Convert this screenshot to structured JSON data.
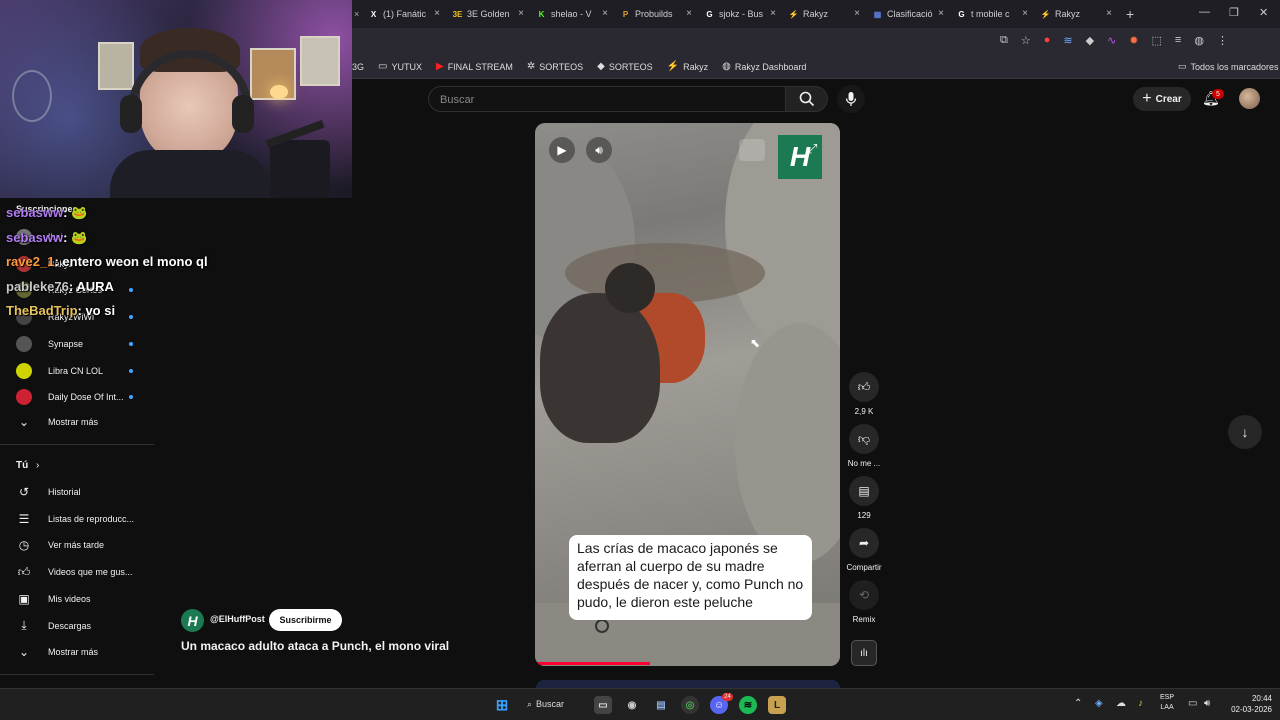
{
  "browser": {
    "tabs": [
      {
        "title": "(1) Fanátic",
        "icon": "x-icon",
        "color": "#ffffff"
      },
      {
        "title": "3E Golden",
        "icon": "3e-icon",
        "color": "#f0c020"
      },
      {
        "title": "shelao - V",
        "icon": "k-icon",
        "color": "#53fc18"
      },
      {
        "title": "Probuilds",
        "icon": "p-icon",
        "color": "#e0a030"
      },
      {
        "title": "sjokz - Bus",
        "icon": "google-icon",
        "color": "#ffffff"
      },
      {
        "title": "Rakyz",
        "icon": "rakyz-icon",
        "color": "#f0b040"
      },
      {
        "title": "Clasificació",
        "icon": "chart-icon",
        "color": "#5a7bd8"
      },
      {
        "title": "t mobile c",
        "icon": "google-icon",
        "color": "#ffffff"
      },
      {
        "title": "Rakyz",
        "icon": "rakyz-icon",
        "color": "#f0b040"
      }
    ],
    "bookmarks": [
      {
        "label": "3G",
        "icon": "none"
      },
      {
        "label": "YUTUX",
        "icon": "folder-icon"
      },
      {
        "label": "FINAL STREAM",
        "icon": "youtube-icon"
      },
      {
        "label": "SORTEOS",
        "icon": "gear-icon"
      },
      {
        "label": "SORTEOS",
        "icon": "diamond-icon"
      },
      {
        "label": "Rakyz",
        "icon": "rakyz-icon"
      },
      {
        "label": "Rakyz Dashboard",
        "icon": "globe-icon"
      }
    ],
    "all_bookmarks": "Todos los marcadores"
  },
  "youtube": {
    "search_placeholder": "Buscar",
    "create_label": "Crear",
    "notifications": "5"
  },
  "sidebar": {
    "subscriptions_header": "Suscripciones",
    "channels": [
      {
        "label": "Ibai",
        "dot": false
      },
      {
        "label": "Rakyz",
        "dot": true
      },
      {
        "label": "Rakyz Cortes",
        "dot": true
      },
      {
        "label": "RakyzWiWi",
        "dot": true
      },
      {
        "label": "Synapse",
        "dot": true
      },
      {
        "label": "Libra CN LOL",
        "dot": true
      },
      {
        "label": "Daily Dose Of Int...",
        "dot": true
      }
    ],
    "show_more_1": "Mostrar más",
    "you_header": "Tú",
    "you_items": [
      {
        "label": "Historial",
        "icon": "history-icon"
      },
      {
        "label": "Listas de reproducc...",
        "icon": "playlist-icon"
      },
      {
        "label": "Ver más tarde",
        "icon": "clock-icon"
      },
      {
        "label": "Videos que me gus...",
        "icon": "thumb-up-icon"
      },
      {
        "label": "Mis videos",
        "icon": "my-videos-icon"
      },
      {
        "label": "Descargas",
        "icon": "download-icon"
      }
    ],
    "show_more_2": "Mostrar más"
  },
  "chat": [
    {
      "user": "sebasww",
      "text": ":",
      "color": "#b27cf4",
      "emote": true
    },
    {
      "user": "sebasww",
      "text": ":",
      "color": "#b27cf4",
      "emote": true
    },
    {
      "user": "rave2_1",
      "text": ": entero weon el mono ql",
      "color": "#ff9b3d",
      "emote": false
    },
    {
      "user": "pableke76",
      "text": ": AURA",
      "color": "#c8c8c8",
      "emote": false
    },
    {
      "user": "TheBadTrip",
      "text": ": vo si",
      "color": "#e8c25b",
      "emote": false
    }
  ],
  "short": {
    "caption": "Las crías de macaco japonés se aferran al cuerpo de su madre después de nacer y, como Punch no pudo, le dieron este peluche",
    "likes": "2,9 K",
    "dislike_label": "No me ...",
    "comments": "129",
    "share_label": "Compartir",
    "remix_label": "Remix",
    "channel": "@ElHuffPost",
    "channel_logo": "H",
    "subscribe_label": "Suscribirme",
    "title": "Un macaco adulto ataca a Punch, el mono viral"
  },
  "taskbar": {
    "search_label": "Buscar",
    "lang_top": "ESP",
    "lang_bottom": "LAA",
    "time": "20:44",
    "date": "02-03-2026",
    "discord_badge": "24"
  }
}
